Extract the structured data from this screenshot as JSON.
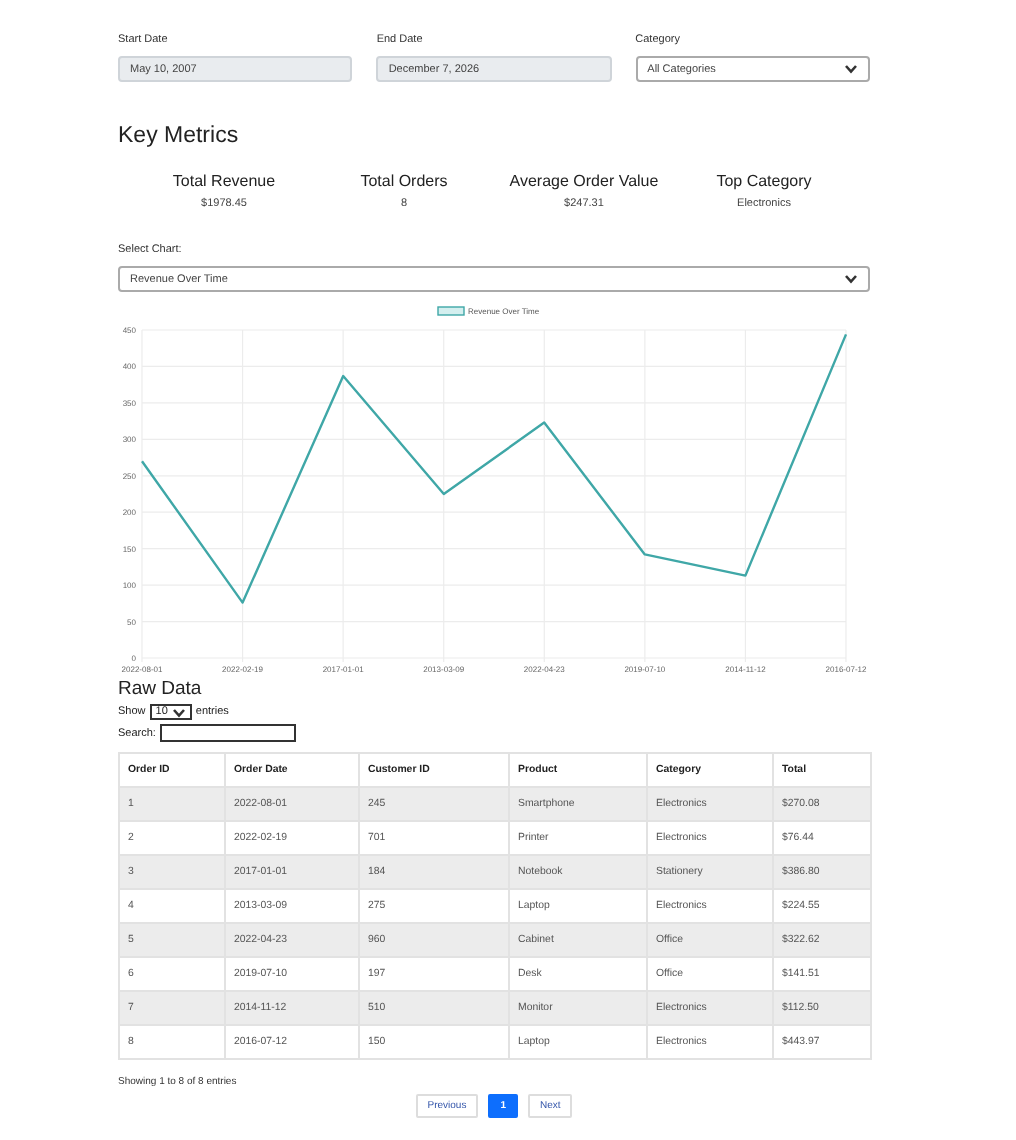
{
  "filters": [
    {
      "label": "Start Date",
      "kind": "date",
      "value": "May 10, 2007"
    },
    {
      "label": "End Date",
      "kind": "date",
      "value": "December 7, 2026"
    },
    {
      "label": "Category",
      "kind": "select",
      "value": "All Categories"
    }
  ],
  "key_metrics": {
    "heading": "Key Metrics",
    "metrics": [
      {
        "label": "Total Revenue",
        "value": "$1978.45"
      },
      {
        "label": "Total Orders",
        "value": "8"
      },
      {
        "label": "Average Order Value",
        "value": "$247.31"
      },
      {
        "label": "Top Category",
        "value": "Electronics"
      }
    ]
  },
  "chart_select": {
    "label": "Select Chart:",
    "value": "Revenue Over Time"
  },
  "chart": {
    "chart_data": {
      "type": "line",
      "categories": [
        "2022-08-01",
        "2022-02-19",
        "2017-01-01",
        "2013-03-09",
        "2022-04-23",
        "2019-07-10",
        "2014-11-12",
        "2016-07-12"
      ],
      "series": [
        {
          "name": "Revenue Over Time",
          "color": "#3fa7a7",
          "values": [
            270,
            76,
            387,
            225,
            323,
            142,
            113,
            444
          ]
        }
      ],
      "grid": true,
      "ylim": [
        0,
        450
      ],
      "yticks": [
        0,
        50,
        100,
        150,
        200,
        250,
        300,
        350,
        400,
        450
      ]
    }
  },
  "raw_data": {
    "heading": "Raw Data",
    "show_label": "Show",
    "page_size": "10",
    "entries_label": "entries",
    "search_label": "Search:",
    "columns": [
      "Order ID",
      "Order Date",
      "Customer ID",
      "Product",
      "Category",
      "Total"
    ],
    "rows": [
      [
        "1",
        "2022-08-01",
        "245",
        "Smartphone",
        "Electronics",
        "$270.08"
      ],
      [
        "2",
        "2022-02-19",
        "701",
        "Printer",
        "Electronics",
        "$76.44"
      ],
      [
        "3",
        "2017-01-01",
        "184",
        "Notebook",
        "Stationery",
        "$386.80"
      ],
      [
        "4",
        "2013-03-09",
        "275",
        "Laptop",
        "Electronics",
        "$224.55"
      ],
      [
        "5",
        "2022-04-23",
        "960",
        "Cabinet",
        "Office",
        "$322.62"
      ],
      [
        "6",
        "2019-07-10",
        "197",
        "Desk",
        "Office",
        "$141.51"
      ],
      [
        "7",
        "2014-11-12",
        "510",
        "Monitor",
        "Electronics",
        "$112.50"
      ],
      [
        "8",
        "2016-07-12",
        "150",
        "Laptop",
        "Electronics",
        "$443.97"
      ]
    ],
    "info": "Showing 1 to 8 of 8 entries",
    "pagination": [
      {
        "label": "Previous",
        "selected": false
      },
      {
        "label": "1",
        "selected": true
      },
      {
        "label": "Next",
        "selected": false
      }
    ]
  }
}
